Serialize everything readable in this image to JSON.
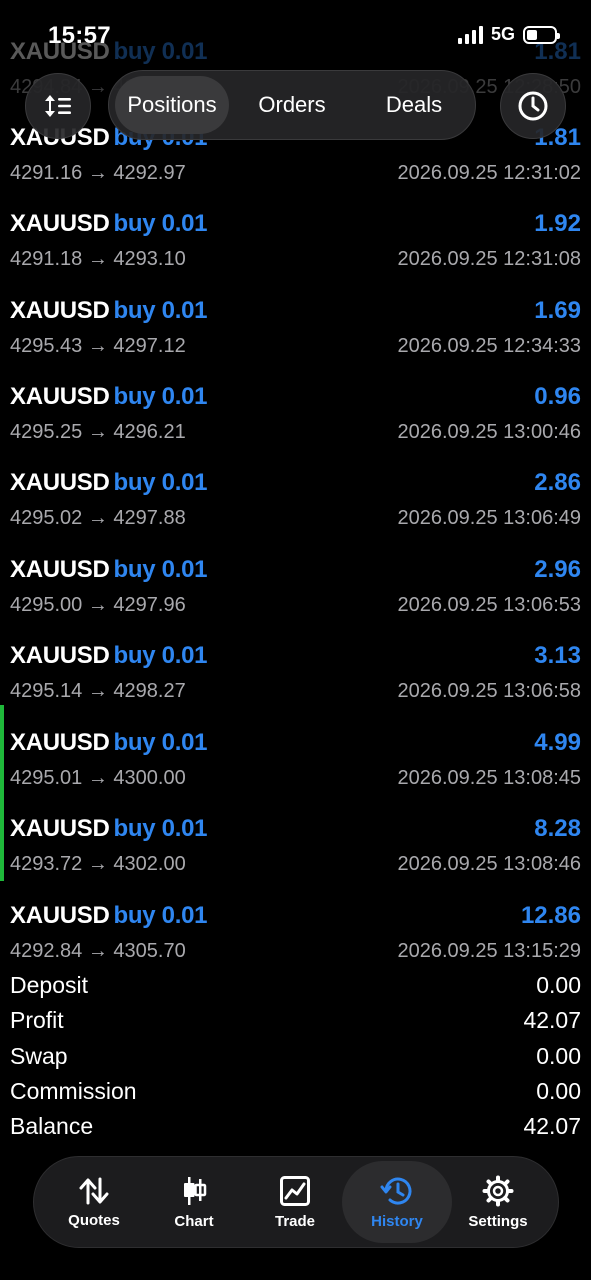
{
  "status_bar": {
    "time": "15:57",
    "network": "5G"
  },
  "header": {
    "segments": [
      "Positions",
      "Orders",
      "Deals"
    ],
    "active_segment": "Positions"
  },
  "deals": [
    {
      "symbol": "XAUUSD",
      "side": "buy 0.01",
      "profit": "1.81",
      "prices": "4294.84 → 4296.15",
      "time": "2026.09.25 12:28:50"
    },
    {
      "symbol": "XAUUSD",
      "side": "buy 0.01",
      "profit": "1.81",
      "prices": "4291.16 → 4292.97",
      "time": "2026.09.25 12:31:02"
    },
    {
      "symbol": "XAUUSD",
      "side": "buy 0.01",
      "profit": "1.92",
      "prices": "4291.18 → 4293.10",
      "time": "2026.09.25 12:31:08"
    },
    {
      "symbol": "XAUUSD",
      "side": "buy 0.01",
      "profit": "1.69",
      "prices": "4295.43 → 4297.12",
      "time": "2026.09.25 12:34:33"
    },
    {
      "symbol": "XAUUSD",
      "side": "buy 0.01",
      "profit": "0.96",
      "prices": "4295.25 → 4296.21",
      "time": "2026.09.25 13:00:46"
    },
    {
      "symbol": "XAUUSD",
      "side": "buy 0.01",
      "profit": "2.86",
      "prices": "4295.02 → 4297.88",
      "time": "2026.09.25 13:06:49"
    },
    {
      "symbol": "XAUUSD",
      "side": "buy 0.01",
      "profit": "2.96",
      "prices": "4295.00 → 4297.96",
      "time": "2026.09.25 13:06:53"
    },
    {
      "symbol": "XAUUSD",
      "side": "buy 0.01",
      "profit": "3.13",
      "prices": "4295.14 → 4298.27",
      "time": "2026.09.25 13:06:58"
    },
    {
      "symbol": "XAUUSD",
      "side": "buy 0.01",
      "profit": "4.99",
      "prices": "4295.01 → 4300.00",
      "time": "2026.09.25 13:08:45"
    },
    {
      "symbol": "XAUUSD",
      "side": "buy 0.01",
      "profit": "8.28",
      "prices": "4293.72 → 4302.00",
      "time": "2026.09.25 13:08:46"
    },
    {
      "symbol": "XAUUSD",
      "side": "buy 0.01",
      "profit": "12.86",
      "prices": "4292.84 → 4305.70",
      "time": "2026.09.25 13:15:29"
    }
  ],
  "summary": [
    {
      "label": "Deposit",
      "value": "0.00"
    },
    {
      "label": "Profit",
      "value": "42.07"
    },
    {
      "label": "Swap",
      "value": "0.00"
    },
    {
      "label": "Commission",
      "value": "0.00"
    },
    {
      "label": "Balance",
      "value": "42.07"
    }
  ],
  "tabs": [
    {
      "label": "Quotes",
      "icon": "quotes-arrows-icon"
    },
    {
      "label": "Chart",
      "icon": "candlestick-icon"
    },
    {
      "label": "Trade",
      "icon": "trade-chart-icon"
    },
    {
      "label": "History",
      "icon": "history-clock-icon",
      "active": true
    },
    {
      "label": "Settings",
      "icon": "gear-icon"
    }
  ],
  "colors": {
    "accent": "#2f86f0",
    "background": "#000000",
    "secondary_text": "#a9a9ad",
    "marker": "#1fb83a"
  }
}
